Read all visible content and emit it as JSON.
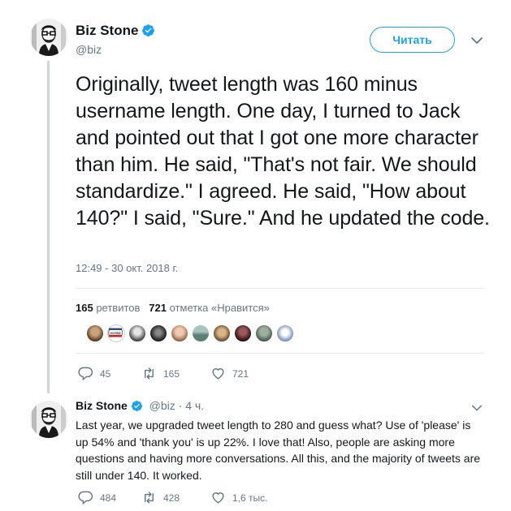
{
  "main_tweet": {
    "author_name": "Biz Stone",
    "author_handle": "@biz",
    "verified_icon": "verified-badge-icon",
    "follow_button_label": "Читать",
    "text": "Originally, tweet length was 160 minus username length. One day, I turned to Jack and pointed out that I got one more character than him. He said, \"That's not fair. We should standardize.\" I agreed. He said, \"How about 140?\" I said, \"Sure.\" And he updated the code.",
    "timestamp": "12:49 - 30 окт. 2018 г.",
    "retweets_count": "165",
    "retweets_label": "ретвитов",
    "likes_count": "721",
    "likes_label": "отметка «Нравится»",
    "liker_avatars": 10,
    "actions": {
      "replies": "45",
      "retweets": "165",
      "likes": "721"
    }
  },
  "reply_tweet": {
    "author_name": "Biz Stone",
    "author_handle": "@biz",
    "separator": "·",
    "time_ago": "4 ч.",
    "text": "Last year, we upgraded tweet length to 280 and guess what? Use of 'please' is up 54% and 'thank you' is up 22%. I love that! Also, people are asking more questions and having more conversations. All this, and the majority of tweets are still under 140. It worked.",
    "actions": {
      "replies": "484",
      "retweets": "428",
      "likes": "1,6 тыс."
    }
  },
  "colors": {
    "accent": "#1da1f2",
    "muted": "#657786",
    "text": "#14171a",
    "divider": "#e6ecf0",
    "thread_line": "#ccd6dd"
  }
}
